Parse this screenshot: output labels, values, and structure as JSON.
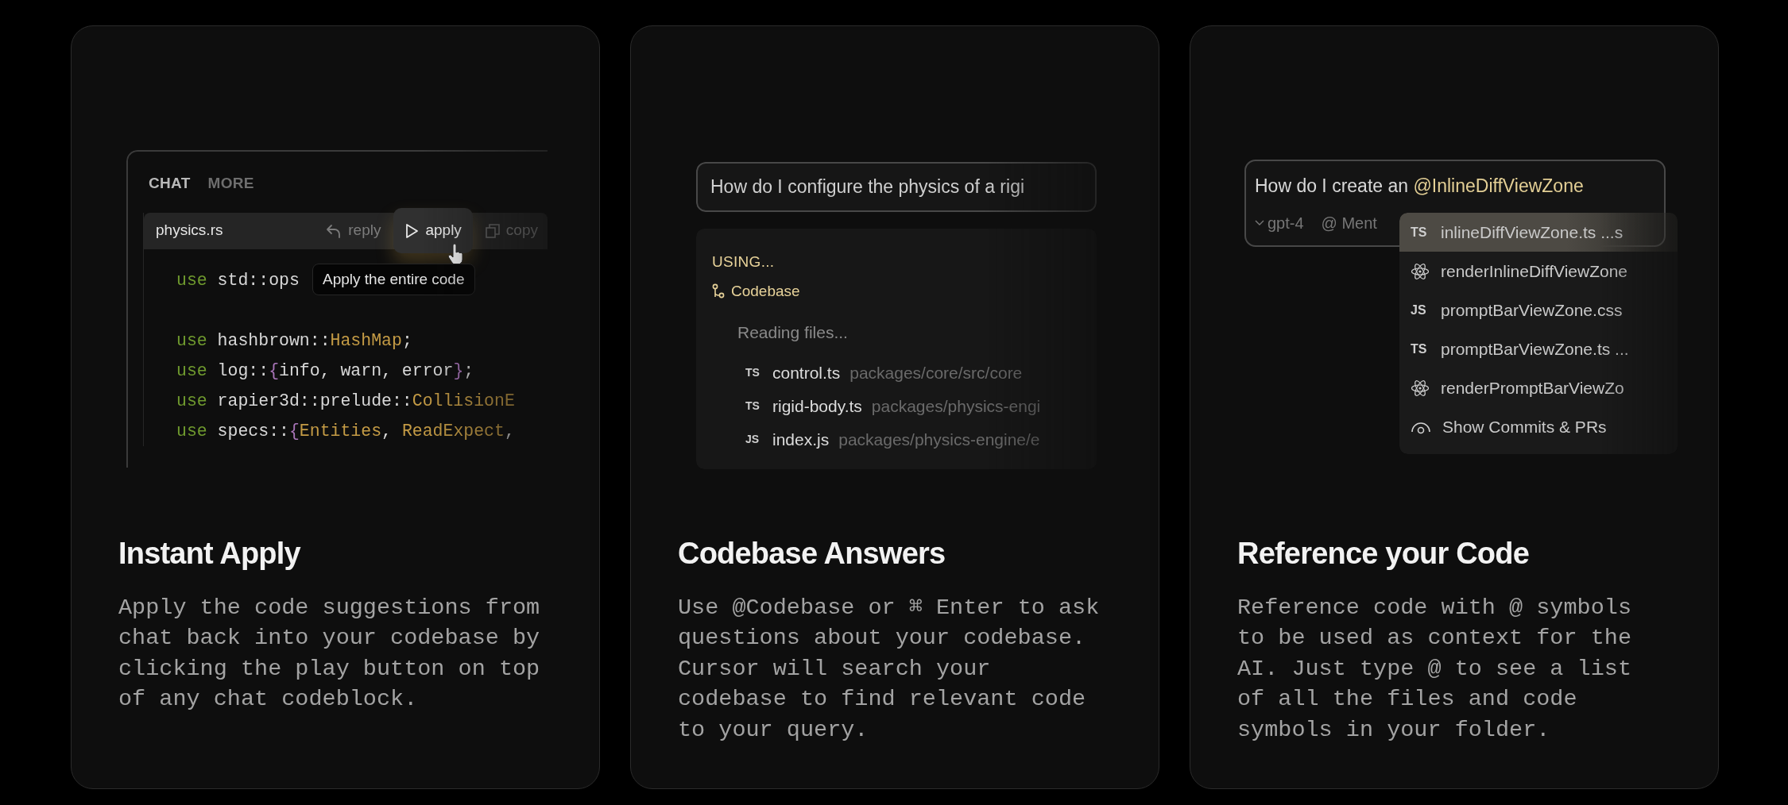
{
  "cards": [
    {
      "kind": "apply",
      "title": "Instant Apply",
      "description": "Apply the code suggestions from chat back into your codebase by clicking the play button on top of any chat codeblock.",
      "demo": {
        "tabs": [
          {
            "label": "CHAT",
            "selected": true
          },
          {
            "label": "MORE",
            "selected": false
          }
        ],
        "file": "physics.rs",
        "actions": [
          {
            "kind": "reply",
            "label": "reply",
            "selected": false
          },
          {
            "kind": "apply",
            "label": "apply",
            "selected": true
          },
          {
            "kind": "copy",
            "label": "copy",
            "selected": false
          }
        ],
        "tooltip": "Apply the entire code",
        "code": [
          {
            "kind": "code",
            "tokens": [
              {
                "kind": "keyword",
                "text": "use"
              },
              {
                "kind": "plain",
                "text": " std::ops"
              }
            ]
          },
          {
            "kind": "blank"
          },
          {
            "kind": "code",
            "tokens": [
              {
                "kind": "keyword",
                "text": "use"
              },
              {
                "kind": "plain",
                "text": " hashbrown::"
              },
              {
                "kind": "type",
                "text": "HashMap"
              },
              {
                "kind": "plain",
                "text": ";"
              }
            ]
          },
          {
            "kind": "code",
            "tokens": [
              {
                "kind": "keyword",
                "text": "use"
              },
              {
                "kind": "plain",
                "text": " log::"
              },
              {
                "kind": "brace",
                "text": "{"
              },
              {
                "kind": "plain",
                "text": "info, warn, error"
              },
              {
                "kind": "brace",
                "text": "}"
              },
              {
                "kind": "plain",
                "text": ";"
              }
            ]
          },
          {
            "kind": "code",
            "tokens": [
              {
                "kind": "keyword",
                "text": "use"
              },
              {
                "kind": "plain",
                "text": " rapier3d::prelude::"
              },
              {
                "kind": "type",
                "text": "CollisionE"
              }
            ]
          },
          {
            "kind": "code",
            "tokens": [
              {
                "kind": "keyword",
                "text": "use"
              },
              {
                "kind": "plain",
                "text": " specs::"
              },
              {
                "kind": "brace",
                "text": "{"
              },
              {
                "kind": "type",
                "text": "Entities"
              },
              {
                "kind": "plain",
                "text": ", "
              },
              {
                "kind": "type",
                "text": "ReadExpect"
              },
              {
                "kind": "plain",
                "text": ","
              }
            ]
          }
        ]
      }
    },
    {
      "kind": "codebase",
      "title": "Codebase Answers",
      "description": "Use @Codebase or ⌘ Enter to ask questions about your codebase. Cursor will search your codebase to find relevant code to your query.",
      "demo": {
        "query": "How do I configure the physics of a rigi",
        "status": "USING...",
        "source": "Codebase",
        "progress": "Reading files...",
        "files": [
          {
            "badge": "TS",
            "name": "control.ts",
            "path": "packages/core/src/core"
          },
          {
            "badge": "TS",
            "name": "rigid-body.ts",
            "path": "packages/physics-engi"
          },
          {
            "badge": "JS",
            "name": "index.js",
            "path": "packages/physics-engine/e"
          }
        ]
      }
    },
    {
      "kind": "reference",
      "title": "Reference your Code",
      "description": "Reference code with @ symbols to be used as context for the AI. Just type @ to see a list of all the files and code symbols in your folder.",
      "demo": {
        "query": [
          {
            "kind": "plain",
            "text": "How do I create an "
          },
          {
            "kind": "mention",
            "text": "@InlineDiffViewZone"
          }
        ],
        "model": "gpt-4",
        "mention": "@ Ment",
        "suggestions": [
          {
            "kind": "file",
            "badge": "TS",
            "label": "inlineDiffViewZone.ts ...s",
            "selected": true
          },
          {
            "kind": "component",
            "label": "renderInlineDiffViewZone",
            "selected": false
          },
          {
            "kind": "file",
            "badge": "JS",
            "label": "promptBarViewZone.css",
            "selected": false
          },
          {
            "kind": "file",
            "badge": "TS",
            "label": "promptBarViewZone.ts ...",
            "selected": false
          },
          {
            "kind": "component",
            "label": "renderPromptBarViewZo",
            "selected": false
          },
          {
            "kind": "commits",
            "label": "Show Commits & PRs",
            "selected": false
          }
        ]
      }
    }
  ]
}
